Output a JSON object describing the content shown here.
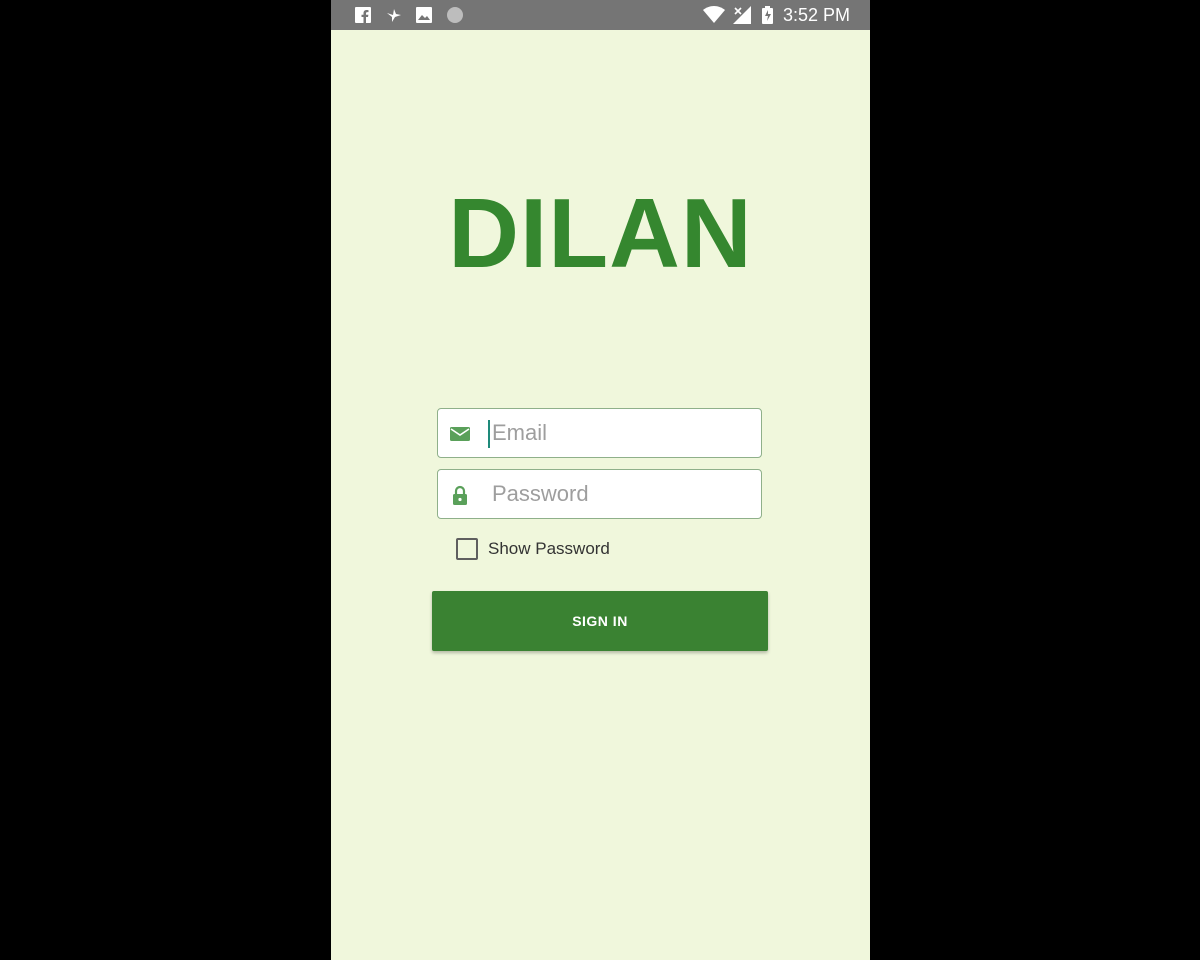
{
  "status_bar": {
    "time": "3:52 PM",
    "left_icons": [
      "facebook-icon",
      "bird-icon",
      "image-icon",
      "circle-icon"
    ],
    "right_icons": [
      "wifi-icon",
      "signal-icon",
      "battery-icon"
    ]
  },
  "app": {
    "logo": "DILAN",
    "accent_color": "#35872f",
    "background_color": "#f0f7dc"
  },
  "form": {
    "email": {
      "placeholder": "Email",
      "value": "",
      "icon": "email-icon"
    },
    "password": {
      "placeholder": "Password",
      "value": "",
      "icon": "lock-icon"
    },
    "show_password": {
      "label": "Show Password",
      "checked": false
    },
    "sign_in_label": "SIGN IN"
  }
}
